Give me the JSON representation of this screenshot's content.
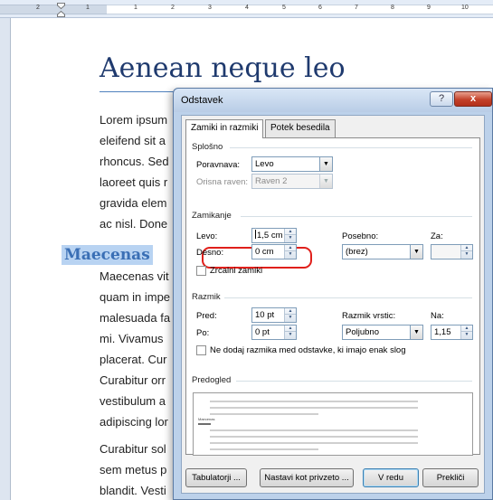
{
  "ruler": {
    "numbers": [
      "2",
      "1",
      "1",
      "2",
      "3",
      "4",
      "5",
      "6",
      "7",
      "8",
      "9",
      "10"
    ]
  },
  "document": {
    "title": "Aenean neque leo",
    "paragraph1": [
      "Lorem ipsum",
      "eleifend sit a",
      "rhoncus. Sed",
      "laoreet quis r",
      "gravida elem",
      "ac nisl. Done"
    ],
    "heading": "Maecenas",
    "paragraph2": [
      "Maecenas vit",
      "quam in impe",
      "malesuada fa",
      "mi. Vivamus",
      "placerat. Cur",
      "Curabitur orr",
      "vestibulum a",
      "adipiscing lor"
    ],
    "paragraph3": [
      "Curabitur sol",
      "sem metus p",
      "blandit. Vesti"
    ]
  },
  "dialog": {
    "title": "Odstavek",
    "help_label": "?",
    "close_label": "x",
    "tabs": [
      {
        "label": "Zamiki in razmiki",
        "active": true
      },
      {
        "label": "Potek besedila",
        "active": false
      }
    ],
    "general": {
      "section": "Splošno",
      "alignment_label": "Poravnava:",
      "alignment_value": "Levo",
      "outline_label": "Orisna raven:",
      "outline_value": "Raven 2"
    },
    "indent": {
      "section": "Zamikanje",
      "left_label": "Levo:",
      "left_value": "1,5 cm",
      "right_label": "Desno:",
      "right_value": "0 cm",
      "special_label": "Posebno:",
      "special_value": "(brez)",
      "by_label": "Za:",
      "by_value": "",
      "mirror_label": "Zrcalni zamiki",
      "mirror_checked": false
    },
    "spacing": {
      "section": "Razmik",
      "before_label": "Pred:",
      "before_value": "10 pt",
      "after_label": "Po:",
      "after_value": "0 pt",
      "line_label": "Razmik vrstic:",
      "line_value": "Poljubno",
      "at_label": "Na:",
      "at_value": "1,15",
      "no_space_label": "Ne dodaj razmika med odstavke, ki imajo enak slog",
      "no_space_checked": false
    },
    "preview": {
      "section": "Predogled",
      "sample_heading": "Maecenas"
    },
    "buttons": {
      "tabs_label": "Tabulatorji ...",
      "default_label": "Nastavi kot privzeto ...",
      "ok_label": "V redu",
      "cancel_label": "Prekliči"
    },
    "colors": {
      "highlight": "#e0201b",
      "close": "#c3412a",
      "heading": "#3a6fb5"
    }
  }
}
